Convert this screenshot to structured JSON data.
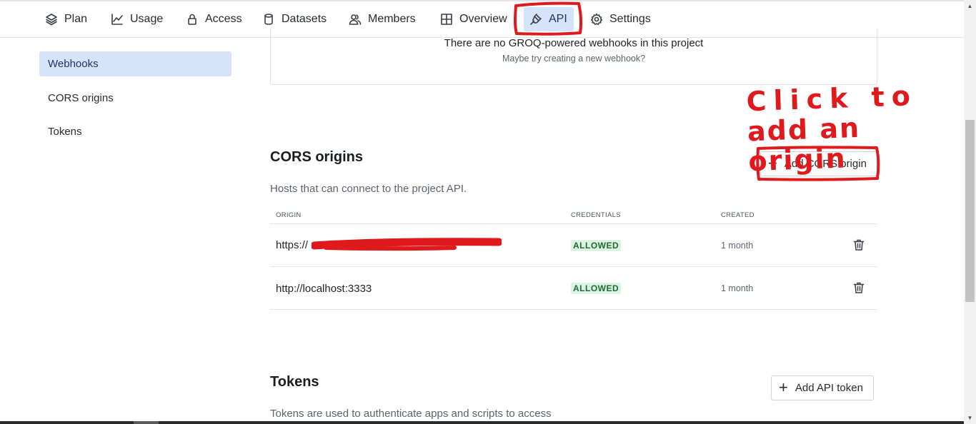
{
  "nav": {
    "tabs": [
      {
        "label": "Plan",
        "icon": "layers-icon"
      },
      {
        "label": "Usage",
        "icon": "line-chart-icon"
      },
      {
        "label": "Access",
        "icon": "lock-icon"
      },
      {
        "label": "Datasets",
        "icon": "database-icon"
      },
      {
        "label": "Members",
        "icon": "users-icon"
      },
      {
        "label": "Overview",
        "icon": "grid-icon"
      },
      {
        "label": "API",
        "icon": "plug-icon",
        "active": true
      },
      {
        "label": "Settings",
        "icon": "gear-icon"
      }
    ]
  },
  "sidebar": {
    "items": [
      {
        "label": "Webhooks",
        "active": true
      },
      {
        "label": "CORS origins"
      },
      {
        "label": "Tokens"
      }
    ]
  },
  "webhooks": {
    "empty_title": "There are no GROQ-powered webhooks in this project",
    "empty_sub": "Maybe try creating a new webhook?"
  },
  "cors": {
    "title": "CORS origins",
    "description": "Hosts that can connect to the project API.",
    "add_button": "Add CORS origin",
    "columns": {
      "origin": "ORIGIN",
      "credentials": "CREDENTIALS",
      "created": "CREATED"
    },
    "rows": [
      {
        "origin": "https://",
        "credentials": "ALLOWED",
        "created": "1 month"
      },
      {
        "origin": "http://localhost:3333",
        "credentials": "ALLOWED",
        "created": "1 month"
      }
    ]
  },
  "tokens": {
    "title": "Tokens",
    "description": "Tokens are used to authenticate apps and scripts to access",
    "add_button": "Add API token"
  },
  "annotation": {
    "text_line1": "Click to",
    "text_line2": "add an origin",
    "color": "#e0191d"
  },
  "colors": {
    "accent_bg": "#d6e4fb",
    "badge_bg": "#dcf3e2",
    "badge_text": "#1d6a33"
  }
}
